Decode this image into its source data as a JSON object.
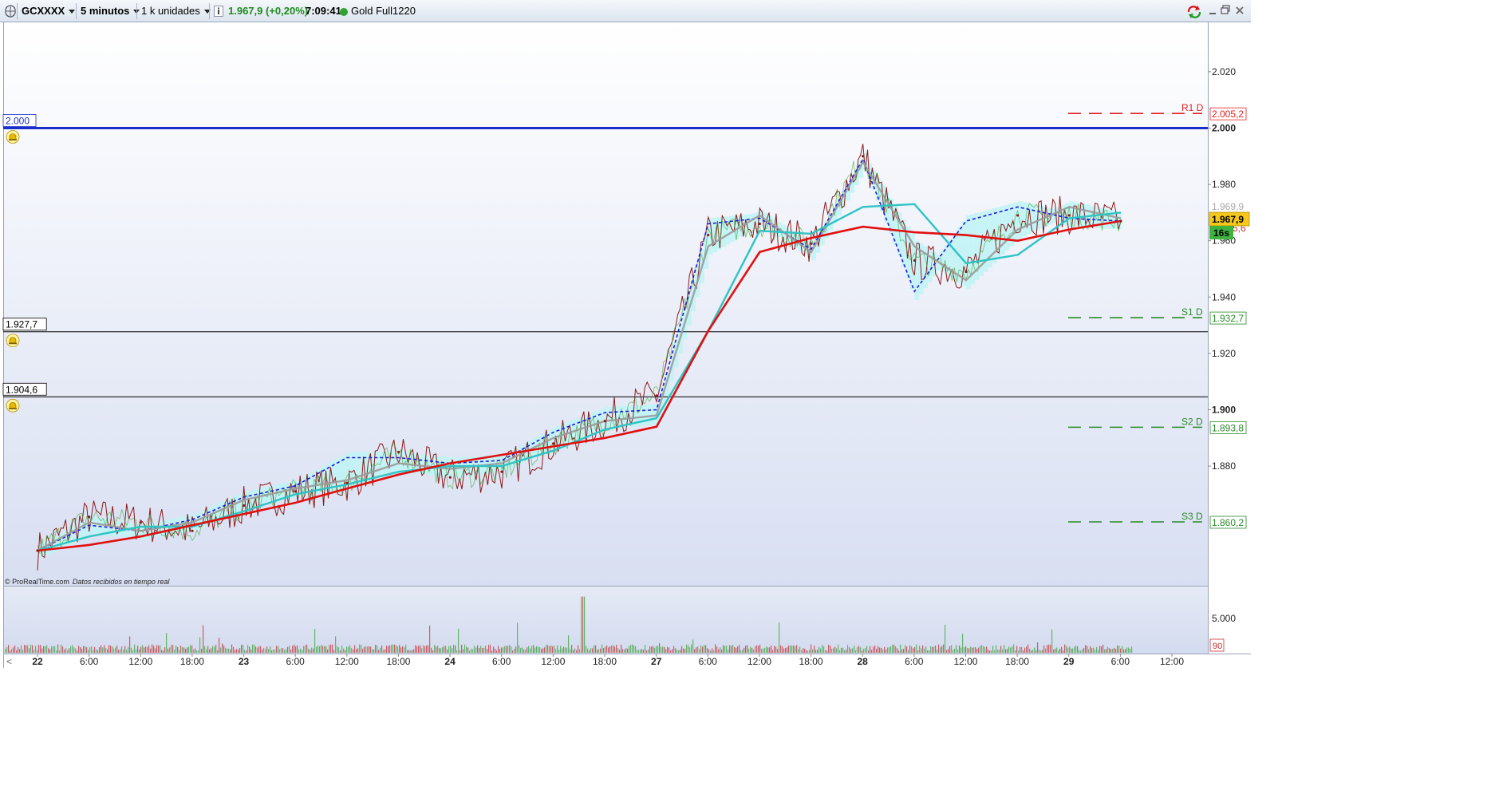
{
  "toolbar": {
    "symbol": "GCXXXX",
    "timeframe": "5 minutos",
    "units": "1 k unidades",
    "price_change": "1.967,9 (+0,20%)",
    "time": "7:09:41",
    "instrument": "Gold Full1220"
  },
  "price_axis": {
    "ticks": [
      "2.020",
      "2.000",
      "1.980",
      "1.960",
      "1.940",
      "1.920",
      "1.900",
      "1.880"
    ],
    "current_price": "1.967,9",
    "countdown": "16s",
    "hidden_label_a": "1.969,9",
    "hidden_label_b": "5,6"
  },
  "pivots": [
    {
      "label": "R1 D",
      "value": "2.005,2",
      "color": "#e02020"
    },
    {
      "label": "S1 D",
      "value": "1.932,7",
      "color": "#2a8a2a"
    },
    {
      "label": "S2 D",
      "value": "1.893,8",
      "color": "#2a8a2a"
    },
    {
      "label": "S3 D",
      "value": "1.860,2",
      "color": "#2a8a2a"
    }
  ],
  "alerts": [
    {
      "label": "2.000",
      "color": "#1a2ecc"
    },
    {
      "label": "1.927,7",
      "color": "#000000"
    },
    {
      "label": "1.904,6",
      "color": "#000000"
    }
  ],
  "time_axis": {
    "labels": [
      {
        "text": "22",
        "bold": true
      },
      {
        "text": "6:00"
      },
      {
        "text": "12:00"
      },
      {
        "text": "18:00"
      },
      {
        "text": "23",
        "bold": true
      },
      {
        "text": "6:00"
      },
      {
        "text": "12:00"
      },
      {
        "text": "18:00"
      },
      {
        "text": "24",
        "bold": true
      },
      {
        "text": "6:00"
      },
      {
        "text": "12:00"
      },
      {
        "text": "18:00"
      },
      {
        "text": "27",
        "bold": true
      },
      {
        "text": "6:00"
      },
      {
        "text": "12:00"
      },
      {
        "text": "18:00"
      },
      {
        "text": "28",
        "bold": true
      },
      {
        "text": "6:00"
      },
      {
        "text": "12:00"
      },
      {
        "text": "18:00"
      },
      {
        "text": "29",
        "bold": true
      },
      {
        "text": "6:00"
      },
      {
        "text": "12:00"
      }
    ]
  },
  "volume_axis": {
    "tick": "5.000",
    "last_volume": "90"
  },
  "watermark": {
    "brand": "© ProRealTime.com",
    "note": "Datos recibidos en tiempo real"
  },
  "colors": {
    "price_line": "#8b1a1a",
    "ma_fast": "#2ec4c4",
    "ma_slow": "#e01010",
    "ma_gray": "#9a9a9a",
    "dashed": "#1a1ae0",
    "cloud": "#bff3f5",
    "alert_line": "#1a2ecc",
    "volume_up": "#3aa83a",
    "volume_down": "#c83232"
  },
  "chart_data": {
    "type": "line",
    "ylim": [
      1845,
      2033
    ],
    "x": [
      "22",
      "6:00",
      "12:00",
      "18:00",
      "23",
      "6:00",
      "12:00",
      "18:00",
      "24",
      "6:00",
      "12:00",
      "18:00",
      "27",
      "6:00",
      "12:00",
      "18:00",
      "28",
      "6:00",
      "12:00",
      "18:00",
      "29",
      "6:00"
    ],
    "series": [
      {
        "values": [
          1850,
          1862,
          1860,
          1857,
          1866,
          1871,
          1874,
          1885,
          1876,
          1878,
          1888,
          1896,
          1905,
          1962,
          1966,
          1959,
          1990,
          1953,
          1949,
          1969,
          1969,
          1967
        ]
      },
      {
        "values": [
          1850,
          1860,
          1857,
          1860,
          1868,
          1872,
          1875,
          1881,
          1879,
          1881,
          1890,
          1896,
          1898,
          1958,
          1969,
          1956,
          1988,
          1958,
          1946,
          1964,
          1972,
          1968
        ]
      },
      {
        "values": [
          1850,
          1859,
          1857,
          1861,
          1869,
          1873,
          1883,
          1883,
          1881,
          1882,
          1892,
          1899,
          1900,
          1966,
          1968,
          1957,
          1989,
          1942,
          1967,
          1972,
          1968,
          1967
        ]
      },
      {
        "values": [
          1850,
          1852,
          1855,
          1859,
          1863,
          1867,
          1872,
          1877,
          1881,
          1884,
          1887,
          1890,
          1894,
          1928,
          1956,
          1961,
          1965,
          1963,
          1962,
          1960,
          1964,
          1967
        ]
      }
    ],
    "volume": {
      "peak_value": 5000
    }
  }
}
